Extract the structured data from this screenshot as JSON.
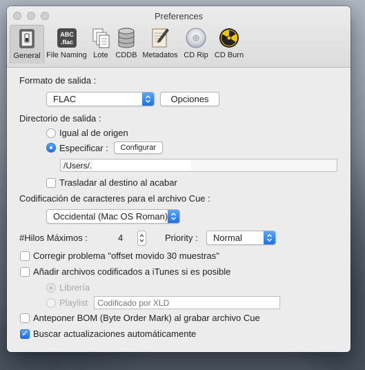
{
  "window": {
    "title": "Preferences"
  },
  "toolbar": {
    "items": [
      {
        "label": "General",
        "icon": "general-switch-icon",
        "selected": true
      },
      {
        "label": "File Naming",
        "icon": "file-naming-icon",
        "icon_text_1": "ABC",
        "icon_text_2": ".flac"
      },
      {
        "label": "Lote",
        "icon": "batch-documents-icon"
      },
      {
        "label": "CDDB",
        "icon": "database-icon"
      },
      {
        "label": "Metadatos",
        "icon": "metadata-edit-icon"
      },
      {
        "label": "CD Rip",
        "icon": "cd-disc-icon"
      },
      {
        "label": "CD Burn",
        "icon": "cd-burn-icon"
      }
    ]
  },
  "output_format": {
    "label": "Formato de salida :",
    "value": "FLAC",
    "options_button": "Opciones"
  },
  "output_dir": {
    "label": "Directorio de salida :",
    "same_as_source": "Igual al de origen",
    "specify": "Especificar :",
    "selected": "specify",
    "configure_button": "Configurar",
    "path": "/Users/.",
    "move_to_dest": {
      "label": "Trasladar al destino al acabar",
      "checked": false
    }
  },
  "cue_encoding": {
    "label": "Codificación de caracteres para el archivo Cue :",
    "value": "Occidental (Mac OS Roman)"
  },
  "threads": {
    "label": "#Hilos Máximos :",
    "value": "4",
    "priority_label": "Priority :",
    "priority_value": "Normal"
  },
  "options": {
    "fix_offset": {
      "label": "Corregir problema \"offset movido 30 muestras\"",
      "checked": false
    },
    "add_itunes": {
      "label": "Añadir archivos codificados a iTunes si es posible",
      "checked": false
    },
    "library": {
      "label": "Librería",
      "selected": true,
      "enabled": false
    },
    "playlist": {
      "label": "Playlist",
      "selected": false,
      "enabled": false,
      "placeholder": "Codificado por XLD"
    },
    "bom": {
      "label": "Anteponer BOM (Byte Order Mark) al grabar archivo Cue",
      "checked": false
    },
    "check_updates": {
      "label": "Buscar actualizaciones automáticamente",
      "checked": true
    }
  },
  "colors": {
    "accent": "#1f6fe5",
    "window_bg": "#ececec"
  }
}
